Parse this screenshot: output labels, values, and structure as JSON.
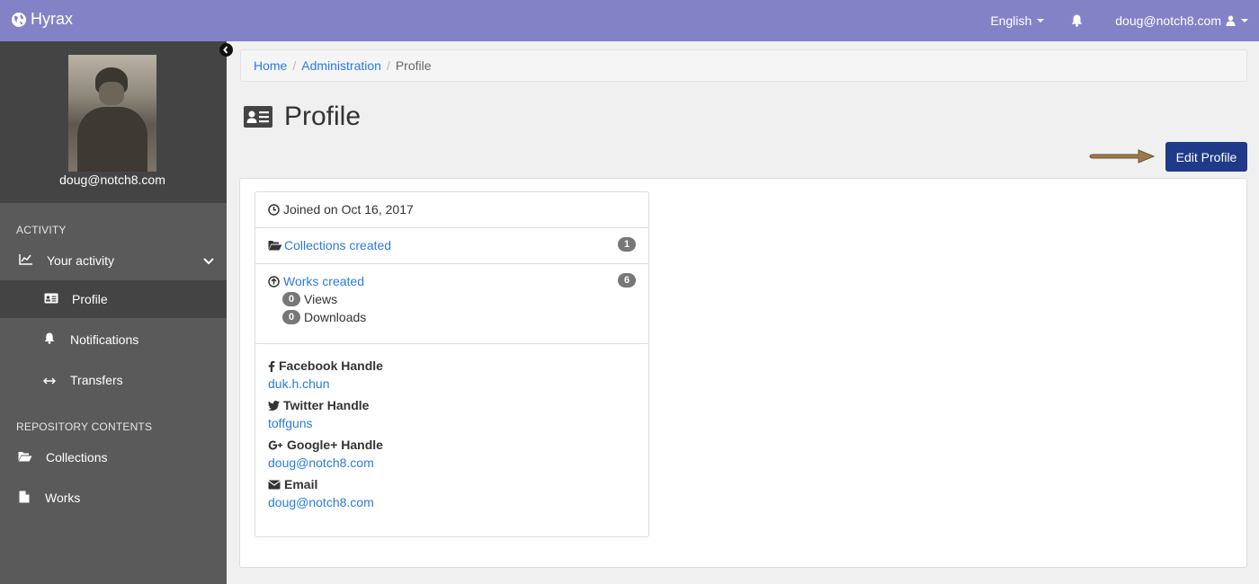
{
  "app": {
    "brand": "Hyrax",
    "language": "English",
    "user_email": "doug@notch8.com"
  },
  "sidebar": {
    "user_email": "doug@notch8.com",
    "activity_title": "ACTIVITY",
    "your_activity": "Your activity",
    "items": [
      {
        "label": "Profile",
        "icon": "profile-card-icon"
      },
      {
        "label": "Notifications",
        "icon": "bell-icon"
      },
      {
        "label": "Transfers",
        "icon": "transfer-arrows-icon"
      }
    ],
    "repo_title": "REPOSITORY CONTENTS",
    "repo_items": [
      {
        "label": "Collections",
        "icon": "folder-open-icon"
      },
      {
        "label": "Works",
        "icon": "file-icon"
      }
    ]
  },
  "breadcrumb": {
    "home": "Home",
    "administration": "Administration",
    "current": "Profile"
  },
  "page": {
    "title": "Profile",
    "edit_button": "Edit Profile"
  },
  "profile": {
    "joined": "Joined on Oct 16, 2017",
    "collections_label": "Collections created",
    "collections_count": "1",
    "works_label": "Works created",
    "works_count": "6",
    "views_count": "0",
    "views_label": "Views",
    "downloads_count": "0",
    "downloads_label": "Downloads",
    "facebook_label": "Facebook Handle",
    "facebook_value": "duk.h.chun",
    "twitter_label": "Twitter Handle",
    "twitter_value": "toffguns",
    "google_label": "Google+ Handle",
    "google_value": "doug@notch8.com",
    "email_label": "Email",
    "email_value": "doug@notch8.com"
  },
  "colors": {
    "topbar": "#8482c7",
    "sidebar": "#5a5a5a",
    "button": "#1f3a88",
    "link": "#2a7ae2"
  }
}
